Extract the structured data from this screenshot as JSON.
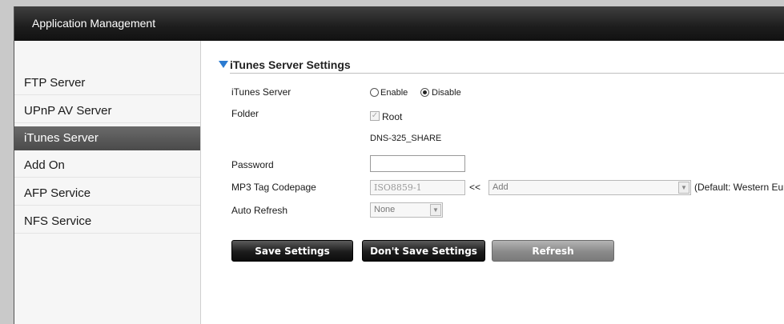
{
  "header": {
    "title": "Application Management"
  },
  "sidebar": {
    "items": [
      {
        "label": "FTP Server"
      },
      {
        "label": "UPnP AV Server"
      },
      {
        "label": "iTunes Server",
        "active": true
      },
      {
        "label": "Add On"
      },
      {
        "label": "AFP Service"
      },
      {
        "label": "NFS Service"
      }
    ]
  },
  "itunes": {
    "section_title": "iTunes Server Settings",
    "server_label": "iTunes Server",
    "enable_label": "Enable",
    "disable_label": "Disable",
    "selected": "Disable",
    "folder_label": "Folder",
    "root_label": "Root",
    "root_checked": true,
    "share_name": "DNS-325_SHARE",
    "password_label": "Password",
    "password_value": "",
    "codepage_label": "MP3 Tag Codepage",
    "codepage_value": "ISO8859-1",
    "arrows": "<<",
    "add_select_value": "Add",
    "default_note": "(Default: Western Eur",
    "refresh_label": "Auto Refresh",
    "refresh_value": "None"
  },
  "buttons": {
    "save": "Save Settings",
    "dont_save": "Don't Save Settings",
    "refresh": "Refresh"
  }
}
